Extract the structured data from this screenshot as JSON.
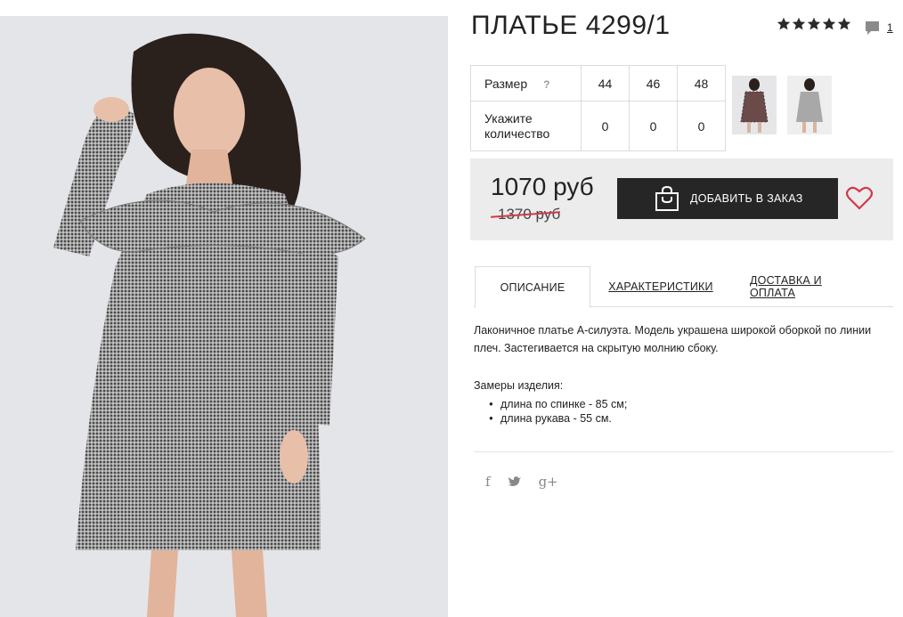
{
  "product": {
    "title": "ПЛАТЬЕ 4299/1",
    "rating_stars": 5,
    "review_count": "1",
    "review_icon": "speech-bubble-icon"
  },
  "sizes": {
    "label": "Размер",
    "help": "?",
    "qty_label": "Укажите количество",
    "columns": [
      "44",
      "46",
      "48"
    ],
    "quantities": [
      "0",
      "0",
      "0"
    ]
  },
  "price": {
    "current": "1070 руб",
    "old": "1370 руб",
    "add_to_order": "ДОБАВИТЬ В ЗАКАЗ"
  },
  "tabs": [
    {
      "label": "ОПИСАНИЕ",
      "active": true
    },
    {
      "label": "ХАРАКТЕРИСТИКИ",
      "active": false
    },
    {
      "label": "ДОСТАВКА И ОПЛАТА",
      "active": false
    }
  ],
  "description": {
    "text": "Лаконичное платье А-силуэта. Модель украшена широкой оборкой по линии плеч. Застегивается на скрытую молнию сбоку.",
    "measure_title": "Замеры изделия:",
    "measures": [
      "длина по спинке - 85 см;",
      "длина рукава - 55 см."
    ]
  },
  "share": {
    "facebook": "f",
    "twitter": "🐦",
    "googleplus": "g+"
  },
  "colors": {
    "button_bg": "#262626",
    "price_box_bg": "#ececec",
    "heart": "#d2384b",
    "old_price_strike": "#d2384b"
  }
}
